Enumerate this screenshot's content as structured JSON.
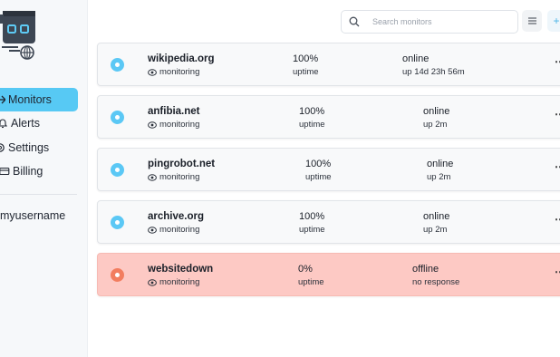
{
  "sidebar": {
    "items": [
      {
        "label": "Monitors",
        "icon": "monitors-icon",
        "active": true
      },
      {
        "label": "Alerts",
        "icon": "bell-icon",
        "active": false
      },
      {
        "label": "Settings",
        "icon": "gear-icon",
        "active": false
      },
      {
        "label": "Billing",
        "icon": "credit-card-icon",
        "active": false
      }
    ],
    "username": "myusername"
  },
  "header": {
    "search_placeholder": "Search monitors"
  },
  "monitors": [
    {
      "name": "wikipedia.org",
      "mode": "monitoring",
      "uptime": "100%",
      "uptime_label": "uptime",
      "status": "online",
      "detail": "up 14d 23h 56m",
      "state": "up"
    },
    {
      "name": "anfibia.net",
      "mode": "monitoring",
      "uptime": "100%",
      "uptime_label": "uptime",
      "status": "online",
      "detail": "up 2m",
      "state": "up"
    },
    {
      "name": "pingrobot.net",
      "mode": "monitoring",
      "uptime": "100%",
      "uptime_label": "uptime",
      "status": "online",
      "detail": "up 2m",
      "state": "up"
    },
    {
      "name": "archive.org",
      "mode": "monitoring",
      "uptime": "100%",
      "uptime_label": "uptime",
      "status": "online",
      "detail": "up 2m",
      "state": "up"
    },
    {
      "name": "websitedown",
      "mode": "monitoring",
      "uptime": "0%",
      "uptime_label": "uptime",
      "status": "offline",
      "detail": "no response",
      "state": "down"
    }
  ],
  "colors": {
    "accent": "#57c9f4",
    "status_up": "#5bc8f5",
    "status_down": "#f27d5f",
    "down_card": "#fdc9c4"
  }
}
